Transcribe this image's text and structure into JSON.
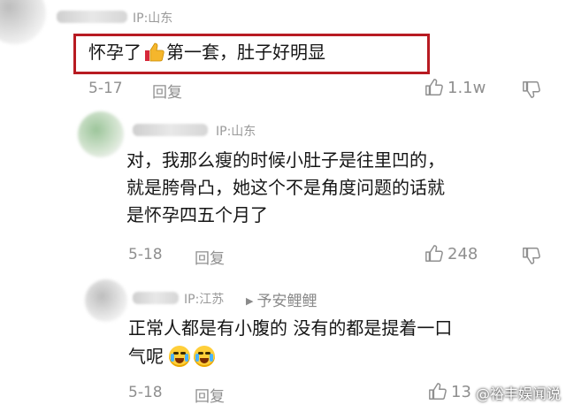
{
  "comments": [
    {
      "ip": "IP:山东",
      "text_part1": "怀孕了",
      "text_part2": "第一套，肚子好明显",
      "inline_icon": "thumbs-up-emoji",
      "date": "5-17",
      "reply_label": "回复",
      "likes": "1.1w"
    },
    {
      "ip": "IP:山东",
      "lines": [
        "对，我那么瘦的时候小肚子是往里凹的，",
        "就是胯骨凸，她这个不是角度问题的话就",
        "是怀孕四五个月了"
      ],
      "date": "5-18",
      "reply_label": "回复",
      "likes": "248"
    },
    {
      "ip": "IP:江苏",
      "reply_to": "予安鲤鲤",
      "lines": [
        "正常人都是有小腹的 没有的都是提着一口",
        "气呢"
      ],
      "inline_icons": [
        "crying-laugh-emoji",
        "crying-laugh-emoji"
      ],
      "date": "5-18",
      "reply_label": "回复",
      "likes": "13"
    }
  ],
  "watermark": "@裕丰娱闻说",
  "icons": {
    "like": "thumbs-up-outline-icon",
    "dislike": "thumbs-down-outline-icon",
    "reply_arrow": "triangle-right-icon"
  },
  "colors": {
    "highlight_border": "#b81b22",
    "meta_text": "#8f8f8f"
  }
}
